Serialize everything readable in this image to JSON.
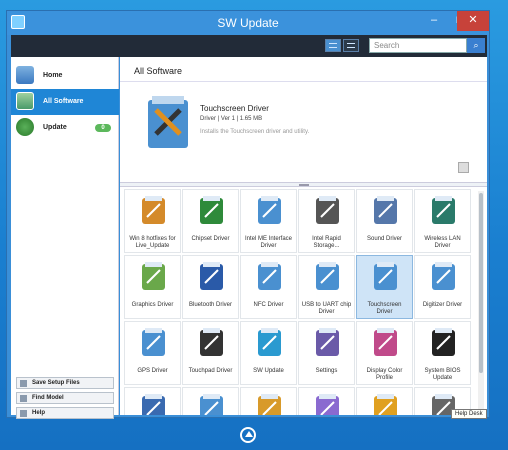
{
  "window": {
    "title": "SW Update"
  },
  "toolbar": {
    "search_placeholder": "Search",
    "search_icon": "magnifier-icon"
  },
  "sidebar": {
    "items": [
      {
        "label": "Home",
        "icon": "home-icon"
      },
      {
        "label": "All Software",
        "icon": "software-icon"
      },
      {
        "label": "Update",
        "icon": "update-icon",
        "badge": "0"
      }
    ],
    "buttons": [
      {
        "label": "Save Setup Files"
      },
      {
        "label": "Find Model"
      },
      {
        "label": "Help"
      }
    ]
  },
  "main": {
    "title": "All Software",
    "detail": {
      "name": "Touchscreen Driver",
      "meta": "Driver  |  Ver 1  |  1.65 MB",
      "description": "Installs the Touchscreen driver and utility."
    },
    "tiles": [
      {
        "label": "Win 8 hotfixes for Live_Update",
        "color": "#d48a2a"
      },
      {
        "label": "Chipset Driver",
        "color": "#2e8a3a"
      },
      {
        "label": "Intel ME Interface Driver",
        "color": "#4a90d0"
      },
      {
        "label": "Intel Rapid Storage...",
        "color": "#555555"
      },
      {
        "label": "Sound Driver",
        "color": "#5577aa"
      },
      {
        "label": "Wireless LAN Driver",
        "color": "#2a7a6a"
      },
      {
        "label": "Graphics Driver",
        "color": "#6aa84a"
      },
      {
        "label": "Bluetooth Driver",
        "color": "#2a5aa8"
      },
      {
        "label": "NFC Driver",
        "color": "#4a90d0"
      },
      {
        "label": "USB to UART chip Driver",
        "color": "#4a90d0"
      },
      {
        "label": "Touchscreen Driver",
        "color": "#4a90d0",
        "selected": true
      },
      {
        "label": "Digitizer Driver",
        "color": "#4a90d0"
      },
      {
        "label": "GPS Driver",
        "color": "#4a90d0"
      },
      {
        "label": "Touchpad Driver",
        "color": "#333333"
      },
      {
        "label": "SW Update",
        "color": "#2a9ad0"
      },
      {
        "label": "Settings",
        "color": "#6a5aa8"
      },
      {
        "label": "Display Color Profile",
        "color": "#c04a8a"
      },
      {
        "label": "System BIOS Update",
        "color": "#222222"
      },
      {
        "label": "",
        "color": "#3a6ab0"
      },
      {
        "label": "",
        "color": "#4a90d0"
      },
      {
        "label": "",
        "color": "#d89a2a"
      },
      {
        "label": "",
        "color": "#8a6ad0"
      },
      {
        "label": "",
        "color": "#e0a020"
      },
      {
        "label": "",
        "color": "#666666"
      }
    ],
    "tooltip": "Help Desk"
  }
}
